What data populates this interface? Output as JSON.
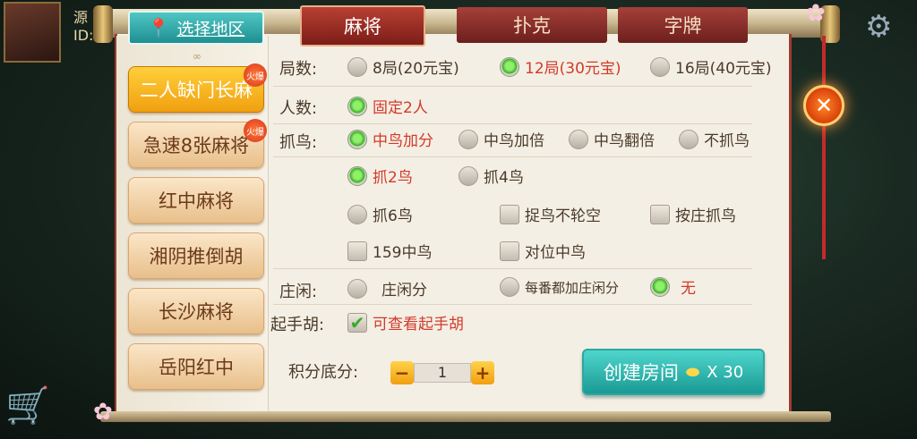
{
  "background": {
    "player_name_partial": "源",
    "id_partial": "ID:"
  },
  "region": {
    "label": "选择地区",
    "pin_icon": "location-pin-icon"
  },
  "tabs": [
    {
      "label": "麻将",
      "active": true
    },
    {
      "label": "扑克",
      "active": false
    },
    {
      "label": "字牌",
      "active": false
    }
  ],
  "games": [
    {
      "label": "二人缺门长麻",
      "hot": true,
      "active": true
    },
    {
      "label": "急速8张麻将",
      "hot": true,
      "active": false
    },
    {
      "label": "红中麻将",
      "hot": false,
      "active": false
    },
    {
      "label": "湘阴推倒胡",
      "hot": false,
      "active": false
    },
    {
      "label": "长沙麻将",
      "hot": false,
      "active": false
    },
    {
      "label": "岳阳红中",
      "hot": false,
      "active": false
    }
  ],
  "hot_badge": "火爆",
  "rounds": {
    "label": "局数:",
    "options": [
      {
        "label": "8局(20元宝)",
        "selected": false
      },
      {
        "label": "12局(30元宝)",
        "selected": true
      },
      {
        "label": "16局(40元宝)",
        "selected": false
      }
    ]
  },
  "players": {
    "label": "人数:",
    "options": [
      {
        "label": "固定2人",
        "selected": true
      }
    ]
  },
  "bird": {
    "label": "抓鸟:",
    "mode_options": [
      {
        "label": "中鸟加分",
        "selected": true
      },
      {
        "label": "中鸟加倍",
        "selected": false
      },
      {
        "label": "中鸟翻倍",
        "selected": false
      },
      {
        "label": "不抓鸟",
        "selected": false
      }
    ],
    "count_options": [
      {
        "label": "抓2鸟",
        "selected": true
      },
      {
        "label": "抓4鸟",
        "selected": false
      },
      {
        "label": "抓6鸟",
        "selected": false
      }
    ],
    "checkboxes": [
      {
        "label": "捉鸟不轮空",
        "checked": false
      },
      {
        "label": "按庄抓鸟",
        "checked": false
      },
      {
        "label": "159中鸟",
        "checked": false
      },
      {
        "label": "对位中鸟",
        "checked": false
      }
    ]
  },
  "dealer": {
    "label": "庄闲:",
    "options": [
      {
        "label": "庄闲分",
        "selected": false
      },
      {
        "label": "每番都加庄闲分",
        "selected": false
      },
      {
        "label": "无",
        "selected": true
      }
    ]
  },
  "starting_hand": {
    "label": "起手胡:",
    "option": {
      "label": "可查看起手胡",
      "checked": true
    }
  },
  "score": {
    "label": "积分底分:",
    "value": "1",
    "minus": "−",
    "plus": "+"
  },
  "create": {
    "label": "创建房间",
    "cost": "X 30",
    "ingot_icon": "gold-ingot-icon"
  },
  "close_symbol": "✕",
  "colors": {
    "accent_red": "#d23a2a",
    "teal": "#1a9a94",
    "gold": "#f0a010",
    "tab_red": "#7c1d18"
  }
}
